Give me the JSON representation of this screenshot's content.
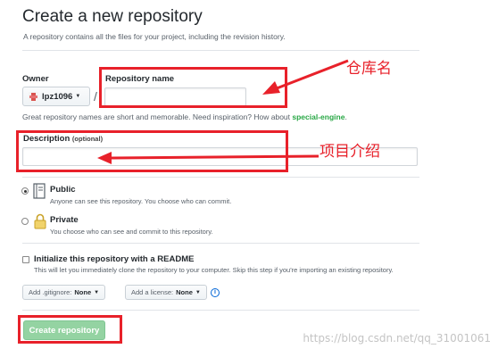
{
  "page": {
    "title": "Create a new repository",
    "subtitle": "A repository contains all the files for your project, including the revision history."
  },
  "owner": {
    "label": "Owner",
    "value": "lpz1096",
    "separator": "/"
  },
  "repo_name": {
    "label": "Repository name",
    "value": "",
    "placeholder": ""
  },
  "hint": {
    "prefix": "Great repository names are short and memorable. Need inspiration? How about ",
    "suggestion": "special-engine",
    "suffix": "."
  },
  "description": {
    "label": "Description",
    "optional": "(optional)",
    "value": "",
    "placeholder": ""
  },
  "visibility": {
    "public": {
      "title": "Public",
      "desc": "Anyone can see this repository. You choose who can commit.",
      "selected": true
    },
    "private": {
      "title": "Private",
      "desc": "You choose who can see and commit to this repository.",
      "selected": false
    }
  },
  "readme": {
    "title": "Initialize this repository with a README",
    "desc": "This will let you immediately clone the repository to your computer. Skip this step if you're importing an existing repository.",
    "checked": false
  },
  "gitignore": {
    "label": "Add .gitignore:",
    "value": "None"
  },
  "license": {
    "label": "Add a license:",
    "value": "None"
  },
  "create_button": {
    "label": "Create repository",
    "disabled": true
  },
  "annotations": {
    "repo_name": "仓库名",
    "description": "项目介绍"
  },
  "watermark": "https://blog.csdn.net/qq_31001061",
  "colors": {
    "annotation_red": "#e8212a",
    "create_button_green": "#94d3a2",
    "suggestion_green": "#28a745",
    "info_blue": "#0366d6"
  },
  "icons": {
    "public": "repo-book-icon",
    "private": "lock-icon",
    "info": "info-icon",
    "owner_avatar": "identicon-avatar"
  }
}
